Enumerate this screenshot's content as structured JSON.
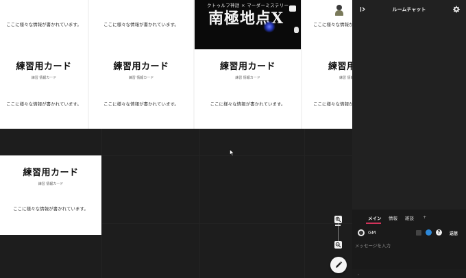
{
  "cards": {
    "info_text": "ここに様々な情報が書かれています。",
    "title": "練習用カード",
    "subtitle": "練習 情報カード"
  },
  "scenario": {
    "subtitle": "クトゥルフ神話 × マーダーミステリー",
    "title": "南極地点X"
  },
  "chat": {
    "title": "ルームチャット",
    "tabs": [
      {
        "label": "メイン"
      },
      {
        "label": "情報"
      },
      {
        "label": "雑談"
      },
      {
        "label": "+"
      }
    ],
    "speaker_name": "GM",
    "send_label": "送信",
    "input_placeholder": "メッセージを入力",
    "help_glyph": "?",
    "footer_glyph": "ˌ"
  },
  "colors": {
    "board_bg": "#1d1d1d",
    "panel_bg": "#212121",
    "accent": "#d1335a",
    "color_picker": "#2d88d8"
  },
  "icons": {
    "collapse": "collapse-panel-icon",
    "settings": "gear-icon",
    "zoom_in": "zoom-in-icon",
    "zoom_out": "zoom-out-icon",
    "edit": "pencil-icon"
  }
}
